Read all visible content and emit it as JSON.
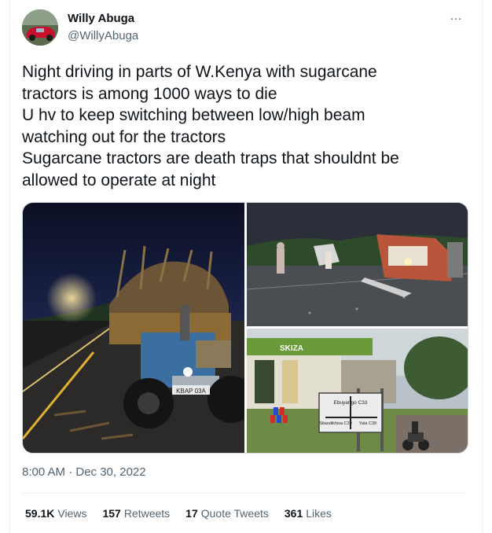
{
  "author": {
    "name": "Willy Abuga",
    "handle": "@WillyAbuga"
  },
  "more_icon": "…",
  "tweet": {
    "lines": [
      "Night driving in parts of W.Kenya with sugarcane",
      "tractors is among 1000 ways to die",
      "U hv to keep switching between low/high beam",
      "watching out for the tractors",
      "Sugarcane tractors are death traps that shouldnt be",
      "allowed to operate at night"
    ]
  },
  "media": {
    "photo1_desc": "tractor-photo",
    "plate_text": "KBAP 03A",
    "sign": {
      "top": "Ebuyango C33",
      "left": "Sitandikhisa C39",
      "right": "Yala C39"
    },
    "shop_sign": "SKIZA"
  },
  "timestamp": "8:00 AM · Dec 30, 2022",
  "stats": {
    "views": {
      "count": "59.1K",
      "label": "Views"
    },
    "retweets": {
      "count": "157",
      "label": "Retweets"
    },
    "quotes": {
      "count": "17",
      "label": "Quote Tweets"
    },
    "likes": {
      "count": "361",
      "label": "Likes"
    }
  }
}
